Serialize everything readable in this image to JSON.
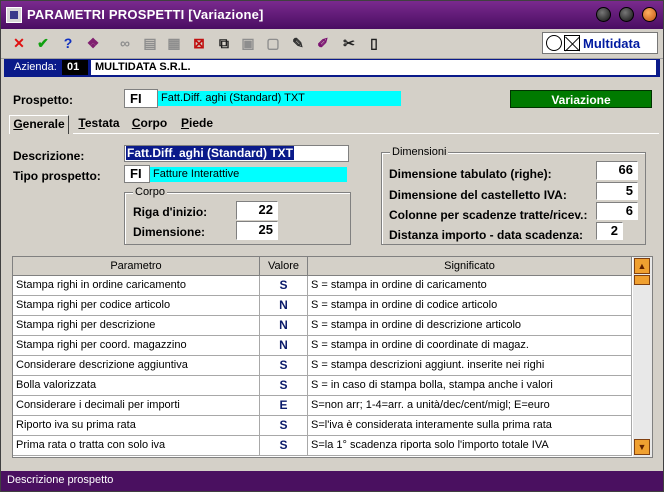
{
  "window": {
    "title": "PARAMETRI PROSPETTI [Variazione]"
  },
  "toolbar": {
    "icons": [
      "close-icon",
      "check-icon",
      "help-icon",
      "book-icon",
      "binoculars-icon",
      "new-record-icon",
      "edit-record-icon",
      "delete-record-icon",
      "copy-icon",
      "paste-icon",
      "blank-page-icon",
      "note-icon",
      "edit-note-icon",
      "tools-icon",
      "document-icon"
    ],
    "logo_text": "Multidata"
  },
  "azienda": {
    "label": "Azienda:",
    "code": "01",
    "name": "MULTIDATA S.R.L."
  },
  "prospetto": {
    "label": "Prospetto:",
    "code": "FI",
    "desc": "Fatt.Diff. aghi (Standard) TXT"
  },
  "mode_button": "Variazione",
  "tabs": [
    {
      "label": "Generale",
      "active": true
    },
    {
      "label": "Testata",
      "active": false
    },
    {
      "label": "Corpo",
      "active": false
    },
    {
      "label": "Piede",
      "active": false
    }
  ],
  "form": {
    "descrizione_label": "Descrizione:",
    "descrizione_value": "Fatt.Diff. aghi (Standard) TXT",
    "tipo_label": "Tipo prospetto:",
    "tipo_code": "FI",
    "tipo_desc": "Fatture Interattive"
  },
  "corpo": {
    "legend": "Corpo",
    "riga_label": "Riga d'inizio:",
    "riga_value": "22",
    "dim_label": "Dimensione:",
    "dim_value": "25"
  },
  "dimensioni": {
    "legend": "Dimensioni",
    "tabulato_label": "Dimensione tabulato (righe):",
    "tabulato_value": "66",
    "castelletto_label": "Dimensione del castelletto IVA:",
    "castelletto_value": "5",
    "colonne_label": "Colonne per scadenze tratte/ricev.:",
    "colonne_value": "6",
    "distanza_label": "Distanza importo - data scadenza:",
    "distanza_value": "2"
  },
  "grid": {
    "headers": [
      "Parametro",
      "Valore",
      "Significato"
    ],
    "rows": [
      {
        "param": "Stampa righi in ordine caricamento",
        "val": "S",
        "sig": "S = stampa in ordine di caricamento"
      },
      {
        "param": "Stampa righi per codice articolo",
        "val": "N",
        "sig": "S = stampa in ordine di codice articolo"
      },
      {
        "param": "Stampa righi per descrizione",
        "val": "N",
        "sig": "S = stampa in ordine di descrizione articolo"
      },
      {
        "param": "Stampa righi per coord. magazzino",
        "val": "N",
        "sig": "S = stampa in ordine di coordinate di magaz."
      },
      {
        "param": "Considerare descrizione aggiuntiva",
        "val": "S",
        "sig": "S = stampa descrizioni aggiunt. inserite nei righi"
      },
      {
        "param": "Bolla valorizzata",
        "val": "S",
        "sig": "S = in caso di stampa bolla, stampa anche i valori"
      },
      {
        "param": "Considerare i decimali per importi",
        "val": "E",
        "sig": "S=non arr; 1-4=arr. a unità/dec/cent/migl; E=euro"
      },
      {
        "param": "Riporto iva su prima rata",
        "val": "S",
        "sig": "S=l'iva è considerata interamente sulla prima rata"
      },
      {
        "param": "Prima rata o tratta con solo iva",
        "val": "S",
        "sig": "S=la 1° scadenza riporta solo l'importo totale IVA"
      }
    ]
  },
  "status_text": "Descrizione prospetto"
}
